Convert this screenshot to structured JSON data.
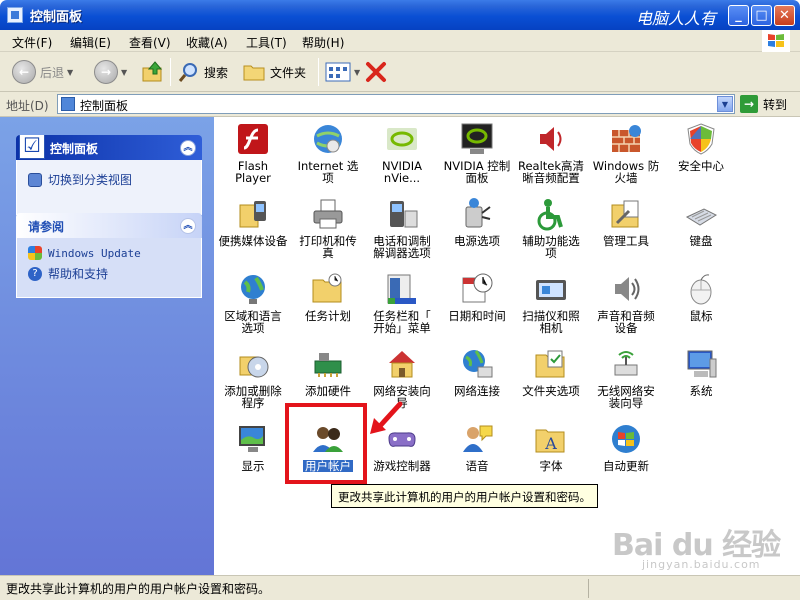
{
  "window": {
    "title": "控制面板",
    "watermark": "电脑人人有",
    "controls": {
      "minimize": "_",
      "maximize": "□",
      "close": "✕"
    }
  },
  "menu": [
    "文件(F)",
    "编辑(E)",
    "查看(V)",
    "收藏(A)",
    "工具(T)",
    "帮助(H)"
  ],
  "toolbar": {
    "back": "后退",
    "search": "搜索",
    "folders": "文件夹"
  },
  "address": {
    "label": "地址(D)",
    "value": "控制面板",
    "go": "转到"
  },
  "sidebar": {
    "panel1": {
      "title": "控制面板",
      "link": "切换到分类视图"
    },
    "panel2": {
      "title": "请参阅",
      "links": [
        "Windows Update",
        "帮助和支持"
      ]
    }
  },
  "items": [
    {
      "label": "Flash\nPlayer",
      "icon": "flash-icon"
    },
    {
      "label": "Internet 选\n项",
      "icon": "globe-icon"
    },
    {
      "label": "NVIDIA\nnVie...",
      "icon": "nvidia-icon"
    },
    {
      "label": "NVIDIA 控制\n面板",
      "icon": "nvidia-panel-icon"
    },
    {
      "label": "Realtek高清\n晰音频配置",
      "icon": "speaker-icon"
    },
    {
      "label": "Windows 防\n火墙",
      "icon": "firewall-icon"
    },
    {
      "label": "安全中心",
      "icon": "shield-icon"
    },
    {
      "label": "便携媒体设备",
      "icon": "media-device-icon"
    },
    {
      "label": "打印机和传\n真",
      "icon": "printer-icon"
    },
    {
      "label": "电话和调制\n解调器选项",
      "icon": "phone-icon"
    },
    {
      "label": "电源选项",
      "icon": "power-icon"
    },
    {
      "label": "辅助功能选\n项",
      "icon": "accessibility-icon"
    },
    {
      "label": "管理工具",
      "icon": "admin-tools-icon"
    },
    {
      "label": "键盘",
      "icon": "keyboard-icon"
    },
    {
      "label": "区域和语言\n选项",
      "icon": "region-globe-icon"
    },
    {
      "label": "任务计划",
      "icon": "task-folder-icon"
    },
    {
      "label": "任务栏和「\n开始」菜单",
      "icon": "taskbar-icon"
    },
    {
      "label": "日期和时间",
      "icon": "clock-icon"
    },
    {
      "label": "扫描仪和照\n相机",
      "icon": "scanner-icon"
    },
    {
      "label": "声音和音频\n设备",
      "icon": "audio-icon"
    },
    {
      "label": "鼠标",
      "icon": "mouse-icon"
    },
    {
      "label": "添加或删除\n程序",
      "icon": "add-remove-icon"
    },
    {
      "label": "添加硬件",
      "icon": "hardware-icon"
    },
    {
      "label": "网络安装向\n导",
      "icon": "network-home-icon"
    },
    {
      "label": "网络连接",
      "icon": "network-icon"
    },
    {
      "label": "文件夹选项",
      "icon": "folder-options-icon"
    },
    {
      "label": "无线网络安\n装向导",
      "icon": "wireless-icon"
    },
    {
      "label": "系统",
      "icon": "system-icon"
    },
    {
      "label": "显示",
      "icon": "display-icon"
    },
    {
      "label": "用户帐户",
      "icon": "users-icon"
    },
    {
      "label": "游戏控制器",
      "icon": "gamepad-icon"
    },
    {
      "label": "语音",
      "icon": "speech-icon"
    },
    {
      "label": "字体",
      "icon": "fonts-icon"
    },
    {
      "label": "自动更新",
      "icon": "windows-update-icon"
    }
  ],
  "tooltip": "更改共享此计算机的用户的用户帐户设置和密码。",
  "statusbar": "更改共享此计算机的用户的用户帐户设置和密码。",
  "baidu_watermark": {
    "logo": "Bai du 经验",
    "url": "jingyan.baidu.com"
  },
  "colors": {
    "titlebar": "#0a4fd4",
    "taskpane": "#6f8fe2",
    "highlight": "#e3141b",
    "selection": "#316ac5"
  }
}
